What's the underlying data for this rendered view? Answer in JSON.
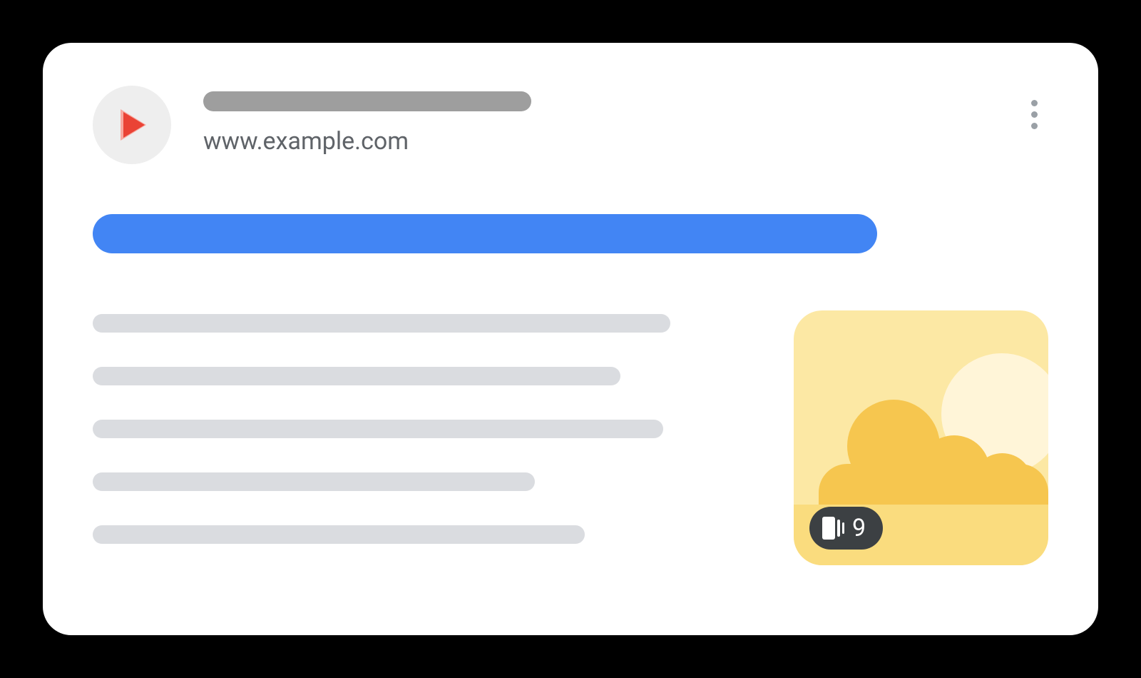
{
  "header": {
    "url": "www.example.com"
  },
  "thumbnail": {
    "page_count": "9"
  }
}
